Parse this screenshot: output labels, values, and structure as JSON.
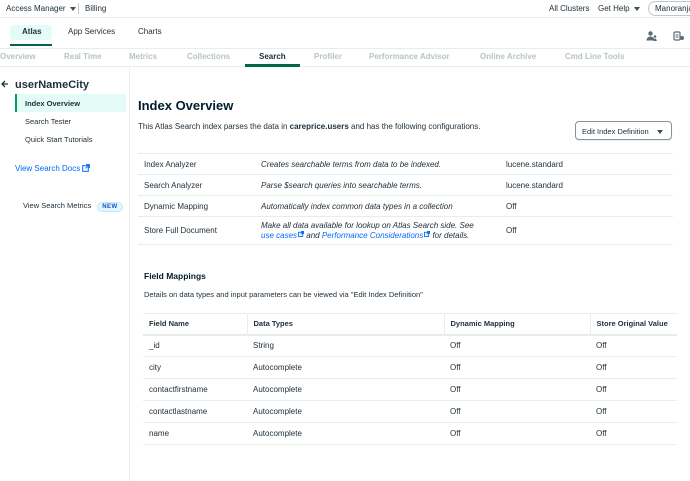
{
  "topbar": {
    "org_label": "Access Manager",
    "billing": "Billing",
    "all_clusters": "All Clusters",
    "get_help": "Get Help",
    "user_name": "Manoranjan"
  },
  "products": [
    {
      "label": "Atlas",
      "active": true
    },
    {
      "label": "App Services",
      "active": false
    },
    {
      "label": "Charts",
      "active": false
    }
  ],
  "section_tabs": [
    {
      "label": "Overview",
      "active": false
    },
    {
      "label": "Real Time",
      "active": false
    },
    {
      "label": "Metrics",
      "active": false
    },
    {
      "label": "Collections",
      "active": false
    },
    {
      "label": "Search",
      "active": true
    },
    {
      "label": "Profiler",
      "active": false
    },
    {
      "label": "Performance Advisor",
      "active": false
    },
    {
      "label": "Online Archive",
      "active": false
    },
    {
      "label": "Cmd Line Tools",
      "active": false
    }
  ],
  "sidebar": {
    "index_name": "userNameCity",
    "items": [
      {
        "label": "Index Overview",
        "active": true
      },
      {
        "label": "Search Tester",
        "active": false
      },
      {
        "label": "Quick Start Tutorials",
        "active": false
      }
    ],
    "docs_link": "View Search Docs",
    "metrics_label": "View Search Metrics",
    "metrics_badge": "NEW"
  },
  "main": {
    "title": "Index Overview",
    "desc_prefix": "This Atlas Search index parses the data in ",
    "desc_collection": "careprice.users",
    "desc_suffix": " and has the following configurations.",
    "edit_button": "Edit Index Definition"
  },
  "config_rows": [
    {
      "name": "Index Analyzer",
      "description": "Creates searchable terms from data to be indexed.",
      "value": "lucene.standard"
    },
    {
      "name": "Search Analyzer",
      "description": "Parse $search queries into searchable terms.",
      "value": "lucene.standard"
    },
    {
      "name": "Dynamic Mapping",
      "description": "Automatically index common data types in a collection",
      "value": "Off"
    },
    {
      "name": "Store Full Document",
      "description": "Make all data available for lookup on Atlas Search side. See",
      "link1": "use cases",
      "and_text": " and ",
      "link2": "Performance Considerations",
      "tail_text": " for details.",
      "value": "Off"
    }
  ],
  "field_mappings": {
    "title": "Field Mappings",
    "description": "Details on data types and input parameters can be viewed via \"Edit Index Definition\"",
    "columns": [
      "Field Name",
      "Data Types",
      "Dynamic Mapping",
      "Store Original Value"
    ],
    "rows": [
      [
        "_id",
        "String",
        "Off",
        "Off"
      ],
      [
        "city",
        "Autocomplete",
        "Off",
        "Off"
      ],
      [
        "contactfirstname",
        "Autocomplete",
        "Off",
        "Off"
      ],
      [
        "contactlastname",
        "Autocomplete",
        "Off",
        "Off"
      ],
      [
        "name",
        "Autocomplete",
        "Off",
        "Off"
      ]
    ]
  },
  "colors": {
    "brand_green": "#00684a",
    "active_bg": "#e3fcf7",
    "link_blue": "#016bf8"
  },
  "icons": [
    "caret-down-icon",
    "users-icon",
    "activity-feed-icon",
    "back-arrow-icon",
    "external-link-icon"
  ]
}
